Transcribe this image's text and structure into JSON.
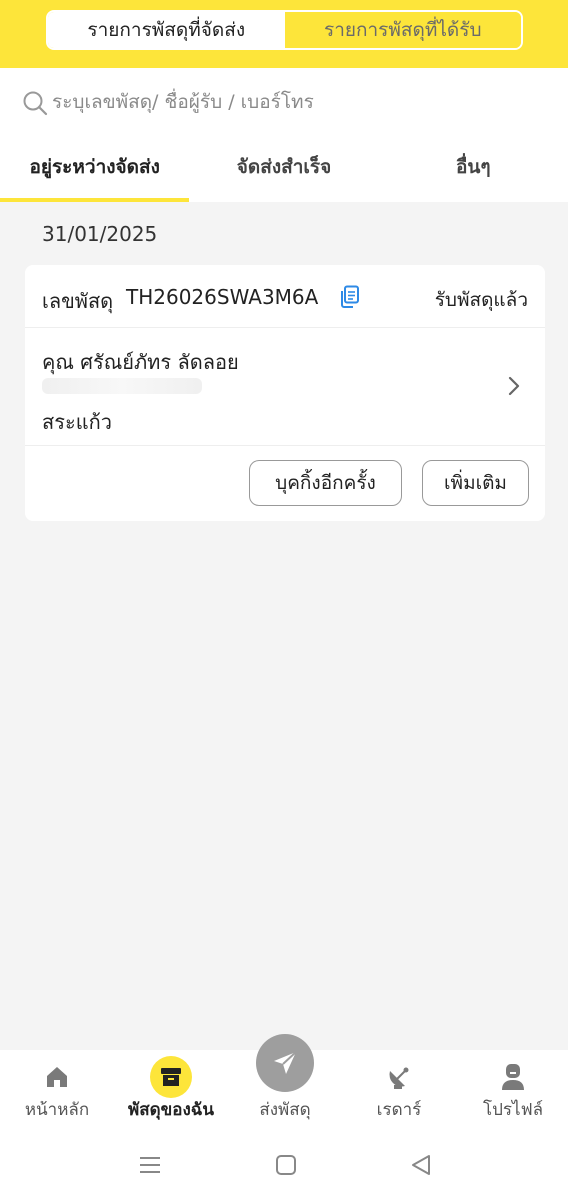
{
  "header": {
    "segments": [
      {
        "label": "รายการพัสดุที่จัดส่ง",
        "active": true
      },
      {
        "label": "รายการพัสดุที่ได้รับ",
        "active": false
      }
    ]
  },
  "search": {
    "placeholder": "ระบุเลขพัสดุ/ ชื่อผู้รับ / เบอร์โทร",
    "value": ""
  },
  "tabs": [
    {
      "label": "อยู่ระหว่างจัดส่ง",
      "active": true
    },
    {
      "label": "จัดส่งสำเร็จ",
      "active": false
    },
    {
      "label": "อื่นๆ",
      "active": false
    }
  ],
  "list": {
    "date": "31/01/2025",
    "parcel": {
      "tracking_label": "เลขพัสดุ",
      "tracking_number": "TH26026SWA3M6A",
      "status": "รับพัสดุแล้ว",
      "recipient": "คุณ ศรัณย์ภัทร ลัดลอย",
      "province": "สระแก้ว",
      "rebook_label": "บุคกิ้งอีกครั้ง",
      "more_label": "เพิ่มเติม"
    }
  },
  "bottom_nav": [
    {
      "label": "หน้าหลัก",
      "icon": "home-icon"
    },
    {
      "label": "พัสดุของฉัน",
      "icon": "parcel-box-icon",
      "active": true
    },
    {
      "label": "ส่งพัสดุ",
      "icon": "send-icon"
    },
    {
      "label": "เรดาร์",
      "icon": "radar-icon"
    },
    {
      "label": "โปรไฟล์",
      "icon": "profile-icon"
    }
  ],
  "colors": {
    "accent": "#fde53a",
    "copy_icon": "#2e8ae6",
    "send_button": "#9e9e9e"
  }
}
